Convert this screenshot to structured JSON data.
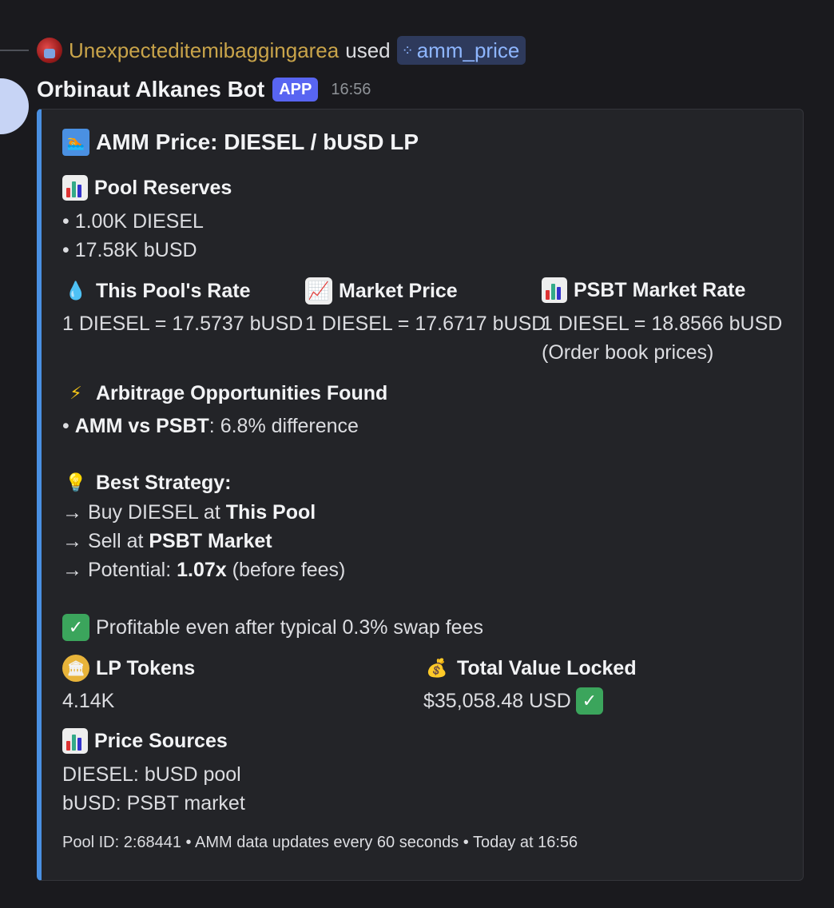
{
  "reply": {
    "username": "Unexpecteditemibaggingarea",
    "used_text": "used",
    "command": "amm_price"
  },
  "message": {
    "bot_name": "Orbinaut Alkanes Bot",
    "badge": "APP",
    "timestamp": "16:56"
  },
  "embed": {
    "title": "AMM Price: DIESEL / bUSD LP",
    "pool_reserves": {
      "title": "Pool Reserves",
      "lines": [
        "• 1.00K DIESEL",
        "• 17.58K bUSD"
      ]
    },
    "this_pool_rate": {
      "title": "This Pool's Rate",
      "value": "1 DIESEL = 17.5737 bUSD"
    },
    "market_price": {
      "title": "Market Price",
      "value": "1 DIESEL = 17.6717 bUSD"
    },
    "psbt_rate": {
      "title": "PSBT Market Rate",
      "value": "1 DIESEL = 18.8566 bUSD",
      "note": "(Order book prices)"
    },
    "arbitrage": {
      "title": "Arbitrage Opportunities Found",
      "bullet_prefix": "• ",
      "bullet_bold": "AMM vs PSBT",
      "bullet_rest": ": 6.8% difference"
    },
    "strategy": {
      "title": "Best Strategy:",
      "line1_prefix": "→ Buy DIESEL at ",
      "line1_bold": "This Pool",
      "line2_prefix": "→ Sell at ",
      "line2_bold": "PSBT Market",
      "line3_prefix": "→ Potential: ",
      "line3_bold": "1.07x",
      "line3_rest": " (before fees)"
    },
    "profit_note": "Profitable even after typical 0.3% swap fees",
    "lp_tokens": {
      "title": "LP Tokens",
      "value": "4.14K"
    },
    "tvl": {
      "title": "Total Value Locked",
      "value": "$35,058.48 USD"
    },
    "price_sources": {
      "title": "Price Sources",
      "lines": [
        "DIESEL: bUSD pool",
        "bUSD: PSBT market"
      ]
    },
    "footer": "Pool ID: 2:68441 • AMM data updates every 60 seconds • Today at 16:56"
  },
  "colors": {
    "accent_bar": "#4a90e2",
    "app_badge": "#5865f2",
    "username": "#c9a44a",
    "command_chip_text": "#8eb6ff"
  }
}
